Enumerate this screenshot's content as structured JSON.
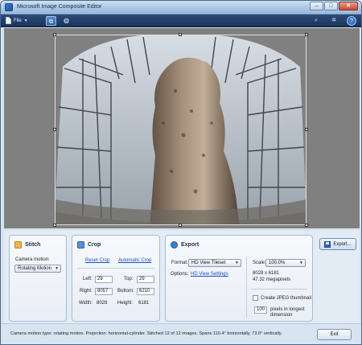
{
  "window": {
    "title": "Microsoft Image Composite Editor",
    "minimize": "–",
    "maximize": "□",
    "close": "✕"
  },
  "toolbar": {
    "file_label": "File",
    "icons": [
      "stitch-view-icon",
      "globe-icon",
      "zoom-icon",
      "settings-icon",
      "help-icon"
    ]
  },
  "stitch": {
    "title": "Stitch",
    "camera_motion_label": "Camera motion:",
    "camera_motion_value": "Rotating Motion"
  },
  "crop": {
    "title": "Crop",
    "reset_link": "Reset Crop",
    "auto_link": "Automatic Crop",
    "left_label": "Left:",
    "left_value": "29",
    "top_label": "Top:",
    "top_value": "29",
    "right_label": "Right:",
    "right_value": "8057",
    "bottom_label": "Bottom:",
    "bottom_value": "6210",
    "width_label": "Width:",
    "width_value": "8028",
    "height_label": "Height:",
    "height_value": "6181"
  },
  "export": {
    "title": "Export",
    "format_label": "Format:",
    "format_value": "HD View Tileset",
    "options_label": "Options:",
    "options_link": "HD View Settings",
    "scale_label": "Scale:",
    "scale_value": "100.0%",
    "dimensions": "8028 x 6181",
    "megapixels": "47.32 megapixels",
    "jpeg_thumbnail_label": "Create JPEG thumbnail",
    "thumb_size_value": "100",
    "thumb_size_label_1": "pixels in longest",
    "thumb_size_label_2": "dimension",
    "export_button": "Export..."
  },
  "status": {
    "text": "Camera motion type: rotating motion. Projection: horizontal-cylinder. Stitched 12 of 12 images. Spans 110.4° horizontally, 73.0° vertically.",
    "exit_button": "Exit"
  },
  "colors": {
    "toolbar_bg": "#1b3459",
    "link": "#1b4fbf",
    "canvas_bg": "#808080"
  }
}
